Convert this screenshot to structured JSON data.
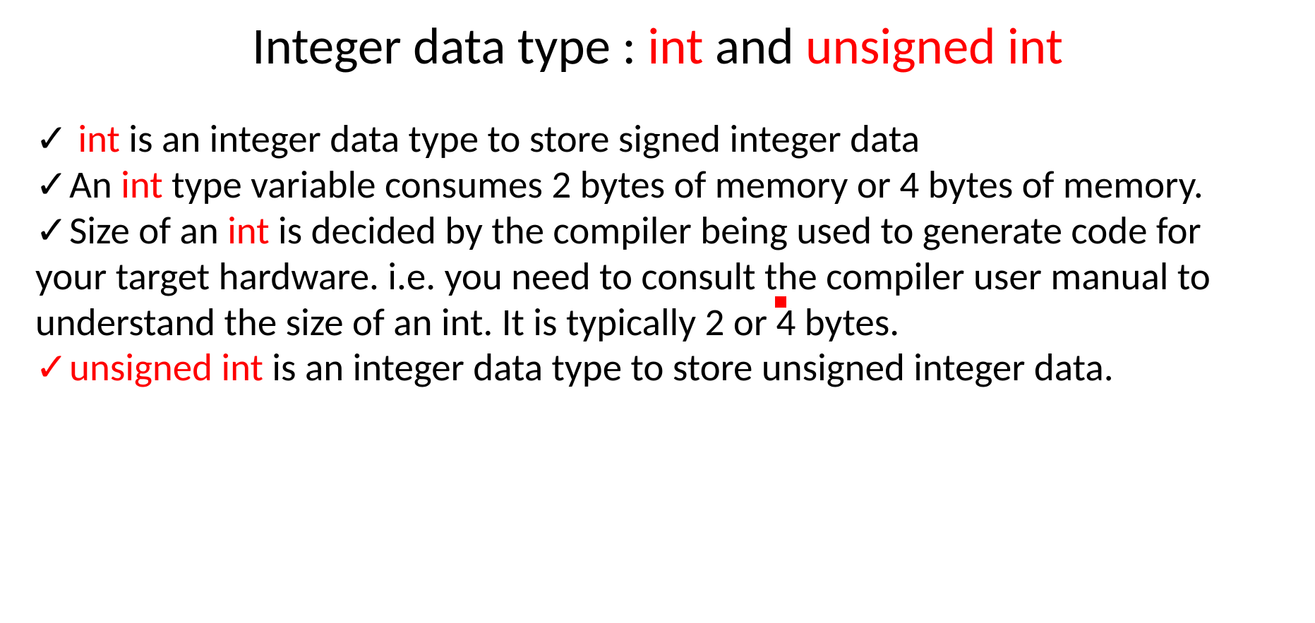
{
  "title": {
    "part1": "Integer data type : ",
    "int": "int",
    "and": " and ",
    "uint": "unsigned int"
  },
  "bullets": {
    "b1": {
      "pre_space": " ",
      "keyword": "int",
      "rest": " is an integer data type to store signed integer data"
    },
    "b2": {
      "pre": "An ",
      "keyword": "int",
      "rest": " type variable consumes 2 bytes of memory or 4 bytes of memory."
    },
    "b3": {
      "pre": "Size of an ",
      "keyword": "int",
      "rest": " is decided by the compiler being used to generate code for your target hardware. i.e. you need to consult the compiler user manual to understand the size of an int. It is typically 2 or 4 bytes."
    },
    "b4": {
      "keyword": "unsigned int",
      "rest": " is an integer data type to store unsigned integer data."
    }
  },
  "glyphs": {
    "check": "✓"
  }
}
